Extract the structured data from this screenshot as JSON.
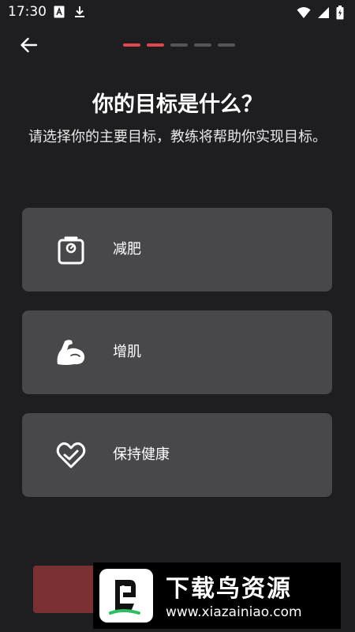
{
  "status_bar": {
    "time": "17:30",
    "icons": [
      "translate-icon",
      "download-icon",
      "wifi-icon",
      "signal-icon",
      "battery-icon"
    ]
  },
  "header": {
    "back_icon": "arrow-left-icon",
    "progress": {
      "total_steps": 5,
      "current_step": 2,
      "active_color": "#e0484e",
      "inactive_color": "#555558"
    }
  },
  "content": {
    "title": "你的目标是什么？",
    "subtitle": "请选择你的主要目标，教练将帮助你实现目标。"
  },
  "options": [
    {
      "label": "减肥",
      "icon": "scale-icon"
    },
    {
      "label": "增肌",
      "icon": "muscle-icon"
    },
    {
      "label": "保持健康",
      "icon": "heart-check-icon"
    }
  ],
  "watermark": {
    "title": "下载鸟资源",
    "url": "www.xiazainiao.com"
  },
  "colors": {
    "background": "#1e1e20",
    "card": "#48484b",
    "accent": "#e0484e",
    "cta": "#7a3033"
  }
}
